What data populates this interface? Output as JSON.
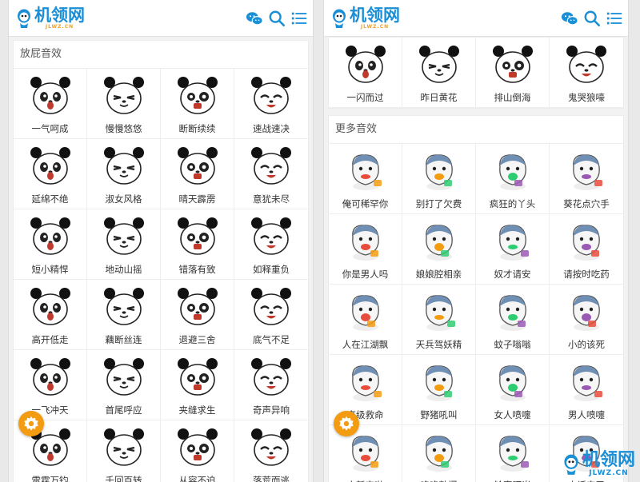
{
  "logo": {
    "text": "机领网",
    "sub": "JLWZ.CN"
  },
  "watermark": {
    "text": "机领网",
    "sub": "JLWZ.CN"
  },
  "colors": {
    "brand": "#1b8fd6",
    "accent": "#f39c12"
  },
  "left": {
    "section_title": "放屁音效",
    "items": [
      "一气呵成",
      "慢慢悠悠",
      "断断续续",
      "速战速决",
      "延绵不绝",
      "淑女风格",
      "晴天霹雳",
      "意犹未尽",
      "短小精悍",
      "地动山摇",
      "错落有致",
      "如释重负",
      "高开低走",
      "藕断丝连",
      "退避三舍",
      "底气不足",
      "一飞冲天",
      "首尾呼应",
      "夹缝求生",
      "奇声异响",
      "雷霆万钧",
      "千回百转",
      "从容不迫",
      "落荒而逃"
    ]
  },
  "right": {
    "top_items": [
      "一闪而过",
      "昨日黄花",
      "排山倒海",
      "鬼哭狼嚎"
    ],
    "section_title": "更多音效",
    "items": [
      "俺可稀罕你",
      "别打了欠费",
      "疯狂的丫头",
      "葵花点穴手",
      "你是男人吗",
      "娘娘腔相亲",
      "奴才请安",
      "请按时吃药",
      "人在江湖飘",
      "天兵驾妖精",
      "蚊子嗡嗡",
      "小的该死",
      "高级救命",
      "野猪吼叫",
      "女人喷嚏",
      "男人喷嚏",
      "小新来啦",
      "咚咚敲门",
      "铃声叮当",
      "电话来了"
    ]
  },
  "icons": {
    "wechat": "wechat-icon",
    "search": "search-icon",
    "menu": "menu-list-icon",
    "settings": "gear-icon"
  }
}
